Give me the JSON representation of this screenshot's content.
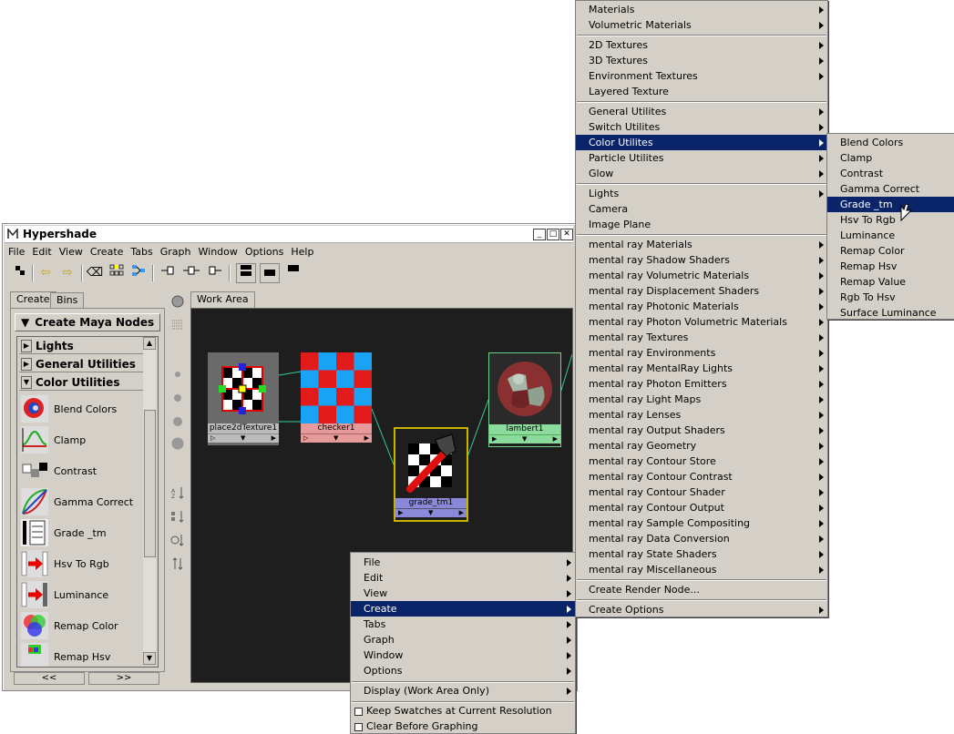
{
  "window": {
    "title": "Hypershade",
    "menubar": [
      "File",
      "Edit",
      "View",
      "Create",
      "Tabs",
      "Graph",
      "Window",
      "Options",
      "Help"
    ]
  },
  "left_panel": {
    "tabs": [
      "Create",
      "Bins"
    ],
    "create_button": "Create Maya Nodes",
    "categories": [
      "Lights",
      "General Utilities",
      "Color Utilities"
    ],
    "nodes": [
      "Blend Colors",
      "Clamp",
      "Contrast",
      "Gamma Correct",
      "Grade _tm",
      "Hsv To Rgb",
      "Luminance",
      "Remap Color",
      "Remap Hsv"
    ],
    "nav": [
      "<<",
      ">>"
    ]
  },
  "work_area": {
    "tab": "Work Area",
    "nodes": [
      "place2dTexture1",
      "checker1",
      "grade_tm1",
      "lambert1"
    ]
  },
  "context_menu": {
    "items": [
      "File",
      "Edit",
      "View",
      "Create",
      "Tabs",
      "Graph",
      "Window",
      "Options"
    ],
    "display_item": "Display (Work Area Only)",
    "check_items": [
      "Keep Swatches at Current Resolution",
      "Clear Before Graphing"
    ]
  },
  "create_menu": {
    "groups": [
      [
        "Materials",
        "Volumetric Materials"
      ],
      [
        "2D Textures",
        "3D Textures",
        "Environment Textures",
        "Layered Texture"
      ],
      [
        "General Utilites",
        "Switch Utilites",
        "Color Utilites",
        "Particle Utilites",
        "Glow"
      ],
      [
        "Lights",
        "Camera",
        "Image Plane"
      ],
      [
        "mental ray Materials",
        "mental ray Shadow Shaders",
        "mental ray Volumetric Materials",
        "mental ray Displacement Shaders",
        "mental ray Photonic Materials",
        "mental ray Photon Volumetric Materials",
        "mental ray Textures",
        "mental ray Environments",
        "mental ray MentalRay Lights",
        "mental ray Photon Emitters",
        "mental ray Light Maps",
        "mental ray Lenses",
        "mental ray Output Shaders",
        "mental ray Geometry",
        "mental ray Contour Store",
        "mental ray Contour Contrast",
        "mental ray Contour Shader",
        "mental ray Contour Output",
        "mental ray Sample Compositing",
        "mental ray Data Conversion",
        "mental ray State Shaders",
        "mental ray Miscellaneous"
      ],
      [
        "Create Render Node..."
      ],
      [
        "Create Options"
      ]
    ]
  },
  "color_utilities_menu": {
    "items": [
      "Blend Colors",
      "Clamp",
      "Contrast",
      "Gamma Correct",
      "Grade _tm",
      "Hsv To Rgb",
      "Luminance",
      "Remap Color",
      "Remap Hsv",
      "Remap Value",
      "Rgb To Hsv",
      "Surface Luminance"
    ],
    "selected": "Grade _tm"
  },
  "colors": {
    "menu_bg": "#d4d0c8",
    "highlight": "#0a246a",
    "work_area_bg": "#1e1e1e",
    "connection": "#33cc99"
  }
}
